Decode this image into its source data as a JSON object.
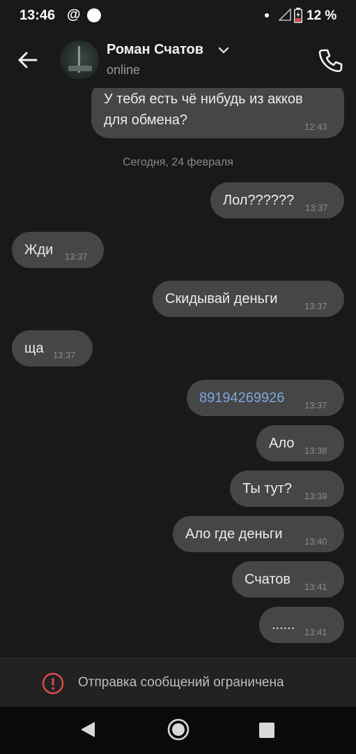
{
  "status_bar": {
    "time": "13:46",
    "at_symbol": "@",
    "battery_percent": "12 %"
  },
  "header": {
    "contact_name": "Роман Счатов",
    "contact_status": "online",
    "back_icon": "arrow-left-icon",
    "call_icon": "phone-icon"
  },
  "messages": [
    {
      "text_line1": "У тебя есть чё нибудь из акков",
      "text_line2": "для обмена?",
      "time": "12:43",
      "outgoing": true
    },
    {
      "text": "Лол??????",
      "time": "13:37",
      "outgoing": true
    },
    {
      "text": "Жди",
      "time": "13:37",
      "outgoing": false
    },
    {
      "text": "Скидывай деньги",
      "time": "13:37",
      "outgoing": true
    },
    {
      "text": "ща",
      "time": "13:37",
      "outgoing": false
    },
    {
      "text": "89194269926",
      "time": "13:37",
      "outgoing": true,
      "is_link": true
    },
    {
      "text": "Ало",
      "time": "13:38",
      "outgoing": true
    },
    {
      "text": "Ты тут?",
      "time": "13:39",
      "outgoing": true
    },
    {
      "text": "Ало где деньги",
      "time": "13:40",
      "outgoing": true
    },
    {
      "text": "Счатов",
      "time": "13:41",
      "outgoing": true
    },
    {
      "text": "......",
      "time": "13:41",
      "outgoing": true
    }
  ],
  "date_separator": "Сегодня, 24 февраля",
  "footer": {
    "notice": "Отправка сообщений ограничена",
    "icon": "alert-circle-icon"
  },
  "colors": {
    "bubble": "#464646",
    "link": "#7aa8df",
    "warning": "#e34b4b",
    "background": "#19191a"
  }
}
